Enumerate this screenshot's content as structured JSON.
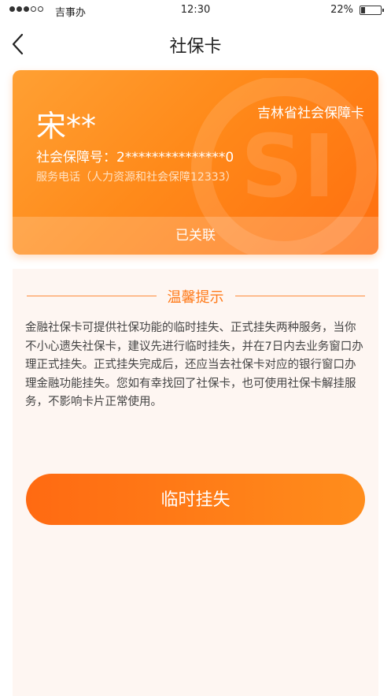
{
  "status_bar": {
    "carrier": "吉事办",
    "time": "12:30",
    "battery": "22%",
    "signal_bars_filled": 3,
    "signal_bars_total": 5
  },
  "nav": {
    "title": "社保卡",
    "back_icon": "chevron-left-icon"
  },
  "card": {
    "province_label": "吉林省社会保障卡",
    "holder_name": "宋**",
    "ssn_line": "社会保障号：2***************0",
    "hotline": "服务电话（人力资源和社会保障12333）",
    "status": "已关联",
    "colors": {
      "start": "#ffa033",
      "end": "#ff6e0e"
    }
  },
  "tips": {
    "title": "温馨提示",
    "body": "金融社保卡可提供社保功能的临时挂失、正式挂失两种服务，当你不小心遗失社保卡，建议先进行临时挂失，并在7日内去业务窗口办理正式挂失。正式挂失完成后，还应当去社保卡对应的银行窗口办理金融功能挂失。您如有幸找回了社保卡，也可使用社保卡解挂服务，不影响卡片正常使用。"
  },
  "action": {
    "temporary_loss_label": "临时挂失",
    "accent_color": "#ff7a1a"
  }
}
